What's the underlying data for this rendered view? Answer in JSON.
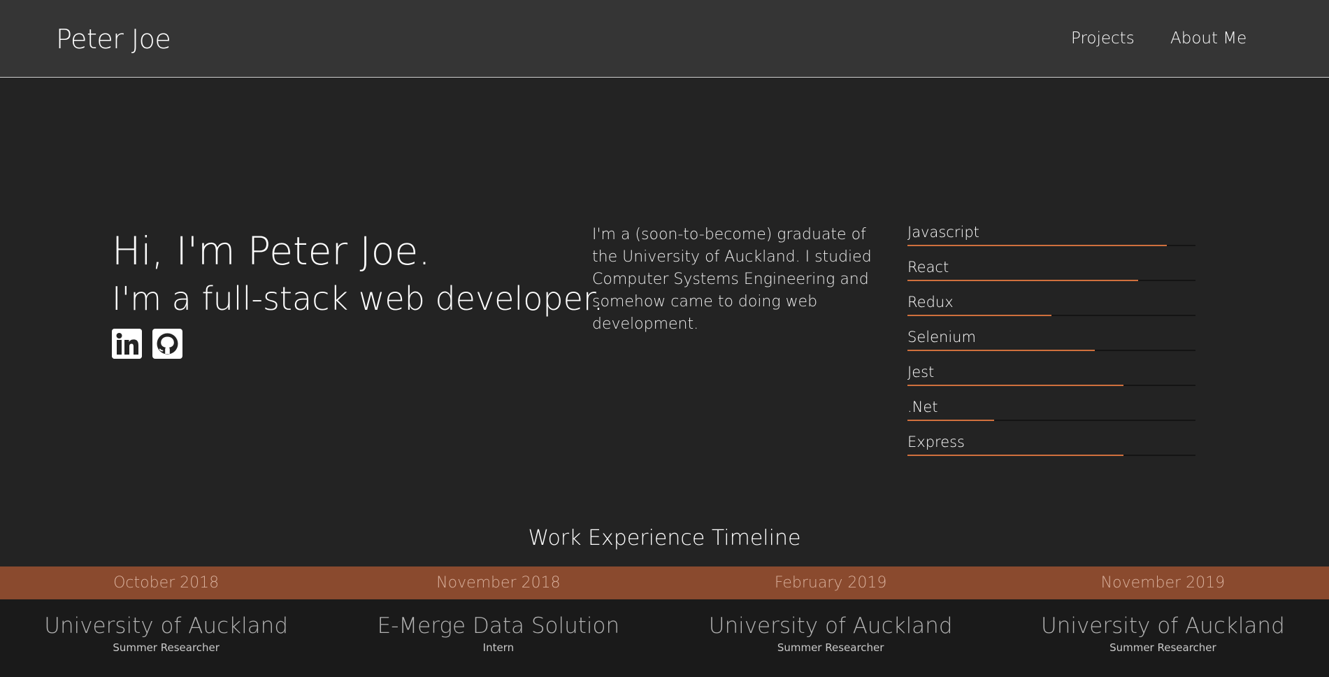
{
  "header": {
    "brand": "Peter Joe",
    "nav": [
      {
        "label": "Projects"
      },
      {
        "label": "About Me"
      }
    ]
  },
  "hero": {
    "title": "Hi, I'm Peter Joe.",
    "subtitle": "I'm a full-stack web developer.",
    "social": [
      {
        "icon": "linkedin-icon"
      },
      {
        "icon": "github-icon"
      }
    ]
  },
  "about": {
    "text": "I'm a (soon-to-become) graduate of the University of Auckland. I studied Computer Systems Engineering and somehow came to doing web development."
  },
  "skills": [
    {
      "name": "Javascript",
      "level": 0.9
    },
    {
      "name": "React",
      "level": 0.8
    },
    {
      "name": "Redux",
      "level": 0.5
    },
    {
      "name": "Selenium",
      "level": 0.65
    },
    {
      "name": "Jest",
      "level": 0.75
    },
    {
      "name": ".Net",
      "level": 0.3
    },
    {
      "name": "Express",
      "level": 0.75
    }
  ],
  "timeline": {
    "title": "Work Experience Timeline",
    "entries": [
      {
        "date": "October 2018",
        "org": "University of Auckland",
        "role": "Summer Researcher"
      },
      {
        "date": "November 2018",
        "org": "E-Merge Data Solution",
        "role": "Intern"
      },
      {
        "date": "February 2019",
        "org": "University of Auckland",
        "role": "Summer Researcher"
      },
      {
        "date": "November 2019",
        "org": "University of Auckland",
        "role": "Summer Researcher"
      }
    ]
  },
  "colors": {
    "accent": "#d0703d",
    "timeline_band": "#8a4a2e",
    "background": "#232323",
    "navbar": "#353535"
  }
}
